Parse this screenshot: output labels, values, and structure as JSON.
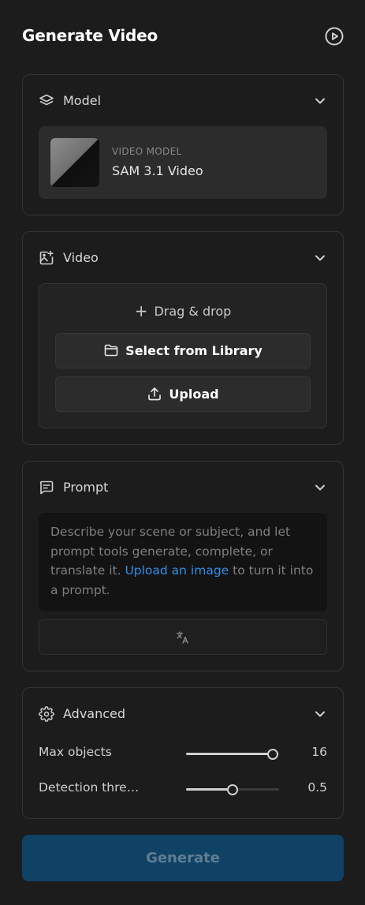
{
  "header": {
    "title": "Generate Video",
    "icon": "play-circle-icon"
  },
  "model": {
    "label": "Model",
    "sub_label": "VIDEO MODEL",
    "name": "SAM 3.1 Video"
  },
  "video": {
    "label": "Video",
    "drag_label": "Drag & drop",
    "library_label": "Select from Library",
    "upload_label": "Upload"
  },
  "prompt": {
    "label": "Prompt",
    "placeholder_before": "Describe your scene or subject, and let prompt tools generate, complete, or translate it. ",
    "link_text": "Upload an image",
    "placeholder_after": " to turn it into a prompt."
  },
  "advanced": {
    "label": "Advanced",
    "rows": [
      {
        "label": "Max objects",
        "value": "16",
        "fraction": 0.93
      },
      {
        "label": "Detection thre…",
        "value": "0.5",
        "fraction": 0.5
      }
    ]
  },
  "generate_label": "Generate",
  "colors": {
    "accent": "#0f4265",
    "link": "#2f8fe8",
    "background": "#1c1c1c"
  }
}
